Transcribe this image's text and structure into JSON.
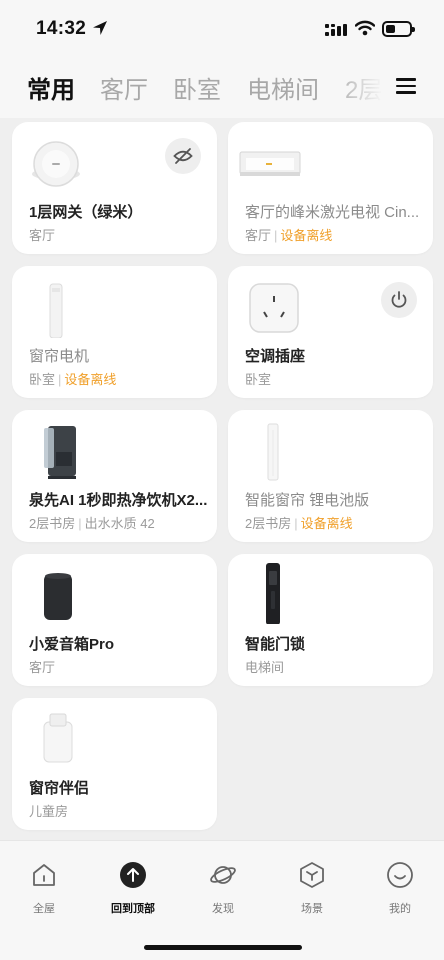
{
  "status_bar": {
    "time": "14:32"
  },
  "tabs": [
    "常用",
    "客厅",
    "卧室",
    "电梯间",
    "2层"
  ],
  "menu_icon": "hamburger-menu-icon",
  "devices": [
    {
      "name": "1层网关（绿米）",
      "room": "客厅",
      "status": "",
      "offline": false,
      "icon": "gateway-icon",
      "corner": "eye-off-icon"
    },
    {
      "name": "客厅的峰米激光电视 Cin...",
      "room": "客厅",
      "status": "设备离线",
      "offline": true,
      "icon": "laser-tv-icon",
      "corner": ""
    },
    {
      "name": "窗帘电机",
      "room": "卧室",
      "status": "设备离线",
      "offline": true,
      "icon": "curtain-motor-icon",
      "corner": ""
    },
    {
      "name": "空调插座",
      "room": "卧室",
      "status": "",
      "offline": false,
      "icon": "ac-socket-icon",
      "corner": "power-icon"
    },
    {
      "name": "泉先AI 1秒即热净饮机X2...",
      "room": "2层书房",
      "status": "出水水质 42",
      "offline": false,
      "icon": "water-dispenser-icon",
      "corner": ""
    },
    {
      "name": "智能窗帘 锂电池版",
      "room": "2层书房",
      "status": "设备离线",
      "offline": true,
      "icon": "smart-curtain-icon",
      "corner": ""
    },
    {
      "name": "小爱音箱Pro",
      "room": "客厅",
      "status": "",
      "offline": false,
      "icon": "speaker-icon",
      "corner": ""
    },
    {
      "name": "智能门锁",
      "room": "电梯间",
      "status": "",
      "offline": false,
      "icon": "door-lock-icon",
      "corner": ""
    },
    {
      "name": "窗帘伴侣",
      "room": "儿童房",
      "status": "",
      "offline": false,
      "icon": "curtain-companion-icon",
      "corner": ""
    }
  ],
  "bottom_nav": [
    {
      "label": "全屋",
      "icon": "home-icon"
    },
    {
      "label": "回到顶部",
      "icon": "arrow-up-icon"
    },
    {
      "label": "发现",
      "icon": "planet-icon"
    },
    {
      "label": "场景",
      "icon": "scene-hexagon-icon"
    },
    {
      "label": "我的",
      "icon": "smile-icon"
    }
  ],
  "colors": {
    "offline_status": "#f0a02b",
    "background": "#efefef",
    "card": "#ffffff",
    "active_tab": "#111111",
    "inactive_tab": "#a8a8a8"
  }
}
